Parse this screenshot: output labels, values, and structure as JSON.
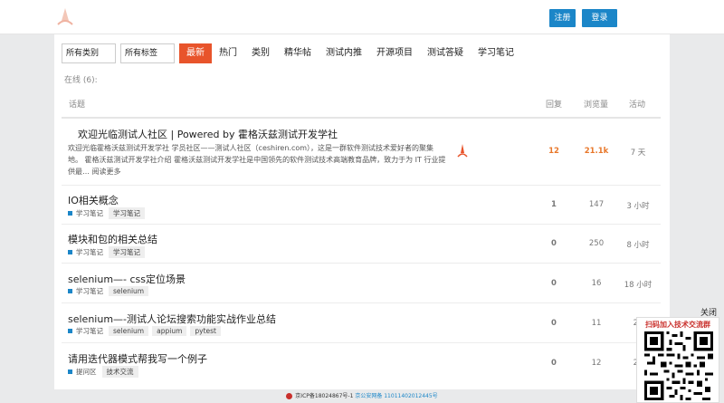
{
  "header": {
    "register_label": "注册",
    "login_label": "登录"
  },
  "filters": {
    "category_select": "所有类别",
    "tag_select": "所有标签"
  },
  "nav": {
    "items": [
      "最新",
      "热门",
      "类别",
      "精华帖",
      "测试内推",
      "开源项目",
      "测试答疑",
      "学习笔记"
    ],
    "active_index": 0
  },
  "online_text": "在线 (6):",
  "table_headers": {
    "topic": "话题",
    "replies": "回复",
    "views": "浏览量",
    "activity": "活动"
  },
  "topics": [
    {
      "title": "欢迎光临测试人社区 | Powered by 霍格沃兹测试开发学社",
      "excerpt": "欢迎光临霍格沃兹测试开发学社 学员社区——测试人社区（ceshiren.com），这是一群软件测试技术爱好者的聚集地。 霍格沃兹测试开发学社介绍 霍格沃兹测试开发学社是中国领先的软件测试技术高端教育品牌，致力于为 IT 行业提供最… 阅读更多",
      "replies": "12",
      "views": "21.1k",
      "activity": "7 天"
    },
    {
      "title": "IO相关概念",
      "category": "学习笔记",
      "tags": [
        "学习笔记"
      ],
      "replies": "1",
      "views": "147",
      "activity": "3 小时"
    },
    {
      "title": "模块和包的相关总结",
      "category": "学习笔记",
      "tags": [
        "学习笔记"
      ],
      "replies": "0",
      "views": "250",
      "activity": "8 小时"
    },
    {
      "title": "selenium—- css定位场景",
      "category": "学习笔记",
      "tags": [
        "selenium"
      ],
      "replies": "0",
      "views": "16",
      "activity": "18 小时"
    },
    {
      "title": "selenium—-测试人论坛搜索功能实战作业总结",
      "category": "学习笔记",
      "tags": [
        "selenium",
        "appium",
        "pytest"
      ],
      "replies": "0",
      "views": "11",
      "activity": "20"
    },
    {
      "title": "请用迭代器模式帮我写一个例子",
      "category": "提问区",
      "tags": [
        "技术交流"
      ],
      "replies": "0",
      "views": "12",
      "activity": "20"
    }
  ],
  "footer": {
    "icp": "京ICP备18024867号-1",
    "police": "京公安网备 11011402012445号"
  },
  "qr_panel": {
    "close_label": "关闭",
    "title": "扫码加入技术交流群"
  },
  "colors": {
    "accent": "#e8542b",
    "primary_button": "#1b86c8",
    "hot_number": "#e8782b"
  }
}
